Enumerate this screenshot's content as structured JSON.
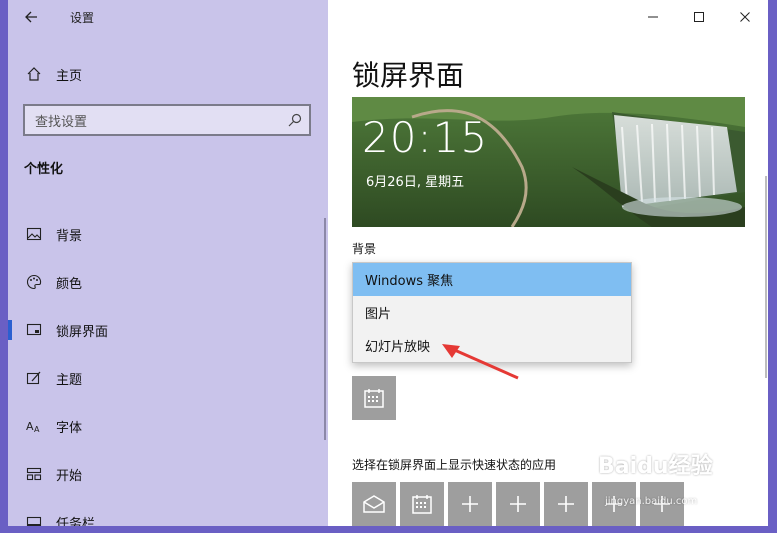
{
  "window": {
    "title": "设置"
  },
  "sidebar": {
    "home_label": "主页",
    "search_placeholder": "查找设置",
    "section_title": "个性化",
    "items": [
      {
        "label": "背景",
        "icon": "picture-icon"
      },
      {
        "label": "颜色",
        "icon": "palette-icon"
      },
      {
        "label": "锁屏界面",
        "icon": "lock-screen-icon",
        "active": true
      },
      {
        "label": "主题",
        "icon": "theme-icon"
      },
      {
        "label": "字体",
        "icon": "font-icon"
      },
      {
        "label": "开始",
        "icon": "start-icon"
      },
      {
        "label": "任务栏",
        "icon": "taskbar-icon"
      }
    ]
  },
  "main": {
    "page_title": "锁屏界面",
    "preview": {
      "time": "20:15",
      "date": "6月26日, 星期五"
    },
    "background_label": "背景",
    "background_options": [
      "Windows 聚焦",
      "图片",
      "幻灯片放映"
    ],
    "selected_option": "Windows 聚焦",
    "quick_status_label": "选择在锁屏界面上显示快速状态的应用"
  },
  "watermark": {
    "brand": "Baidu经验",
    "url": "jingyan.baidu.com"
  },
  "colors": {
    "sidebar_bg": "#c9c4ea",
    "accent": "#2b5fd0",
    "dropdown_selected": "#7fbef2",
    "tile_bg": "#9e9e9e",
    "arrow": "#e53935"
  }
}
